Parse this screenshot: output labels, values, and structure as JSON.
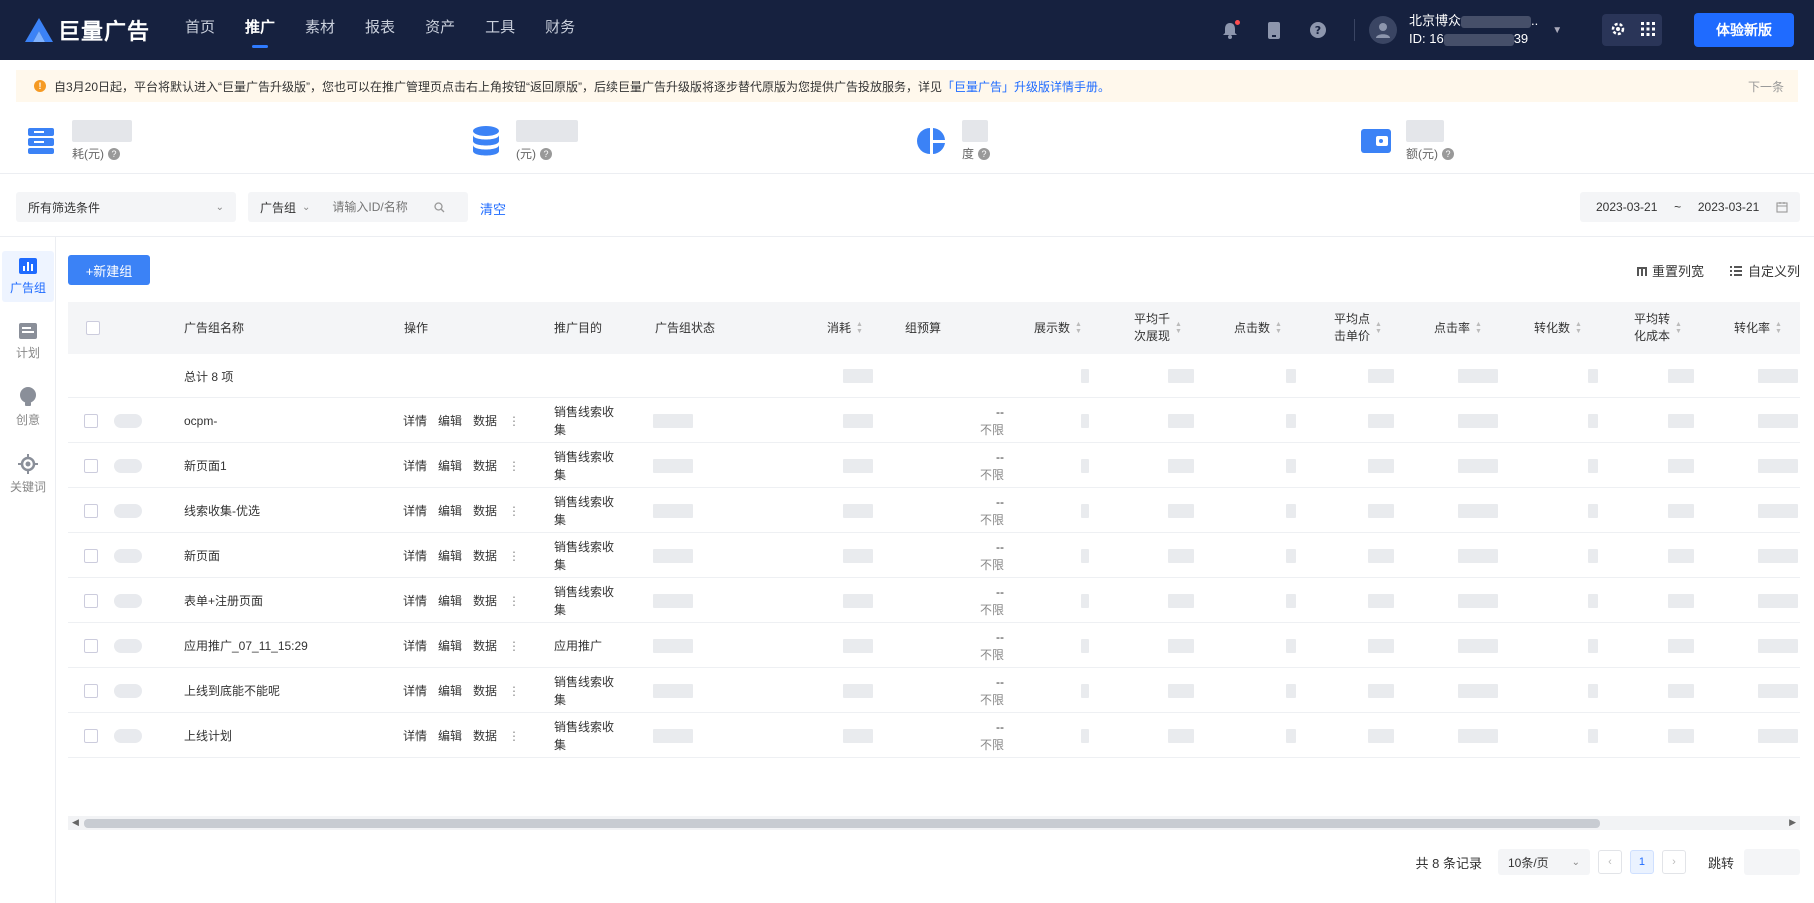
{
  "header": {
    "logo_text": "巨量广告",
    "nav": [
      "首页",
      "推广",
      "素材",
      "报表",
      "资产",
      "工具",
      "财务"
    ],
    "active_nav": "推广",
    "account_name": "北京博众",
    "account_name_suffix": "..",
    "account_id_prefix": "ID: 16",
    "account_id_suffix": "39",
    "new_version_button": "体验新版",
    "icons": [
      "bell-icon",
      "phone-icon",
      "help-icon",
      "user-icon",
      "settings-icon",
      "grid-icon"
    ]
  },
  "notice": {
    "text": "自3月20日起，平台将默认进入“巨量广告升级版”，您也可以在推广管理页点击右上角按钮“返回原版”，后续巨量广告升级版将逐步替代原版为您提供广告投放服务，详见",
    "link": "「巨量广告」升级版详情手册",
    "suffix": "。",
    "next": "下一条"
  },
  "stats": [
    {
      "label": "耗(元)",
      "icon": "wallet-stack-icon"
    },
    {
      "label": "(元)",
      "icon": "database-icon"
    },
    {
      "label": "度",
      "icon": "pie-chart-icon"
    },
    {
      "label": "额(元)",
      "icon": "card-wallet-icon"
    }
  ],
  "filters": {
    "all_conditions": "所有筛选条件",
    "dimension": "广告组",
    "search_placeholder": "请输入ID/名称",
    "clear": "清空",
    "date_start": "2023-03-21",
    "date_sep": "~",
    "date_end": "2023-03-21"
  },
  "sidebar": [
    {
      "label": "广告组",
      "icon": "bar-chart-icon",
      "active": true
    },
    {
      "label": "计划",
      "icon": "plan-icon",
      "active": false
    },
    {
      "label": "创意",
      "icon": "bulb-icon",
      "active": false
    },
    {
      "label": "关键词",
      "icon": "keyword-icon",
      "active": false
    }
  ],
  "toolbar": {
    "new_group": "+新建组",
    "reset_width": "重置列宽",
    "custom_columns": "自定义列"
  },
  "table": {
    "headers": {
      "name": "广告组名称",
      "ops": "操作",
      "purpose": "推广目的",
      "status": "广告组状态",
      "cost": "消耗",
      "budget": "组预算",
      "impressions": "展示数",
      "cpm_1": "平均千",
      "cpm_2": "次展现",
      "clicks": "点击数",
      "cpc_1": "平均点",
      "cpc_2": "击单价",
      "ctr": "点击率",
      "conversions": "转化数",
      "cpa_1": "平均转",
      "cpa_2": "化成本",
      "cvr": "转化率"
    },
    "total": "总计 8 项",
    "op_labels": [
      "详情",
      "编辑",
      "数据"
    ],
    "budget_dash": "--",
    "budget_unlimited": "不限",
    "rows": [
      {
        "name": "ocpm-",
        "purpose_1": "销售线索收",
        "purpose_2": "集"
      },
      {
        "name": "新页面1",
        "purpose_1": "销售线索收",
        "purpose_2": "集"
      },
      {
        "name": "线索收集-优选",
        "purpose_1": "销售线索收",
        "purpose_2": "集"
      },
      {
        "name": "新页面",
        "purpose_1": "销售线索收",
        "purpose_2": "集"
      },
      {
        "name": "表单+注册页面",
        "purpose_1": "销售线索收",
        "purpose_2": "集"
      },
      {
        "name": "应用推广_07_11_15:29",
        "purpose_1": "应用推广",
        "purpose_2": ""
      },
      {
        "name": "上线到底能不能呢",
        "purpose_1": "销售线索收",
        "purpose_2": "集"
      },
      {
        "name": "上线计划",
        "purpose_1": "销售线索收",
        "purpose_2": "集"
      }
    ]
  },
  "pagination": {
    "total_text": "共 8 条记录",
    "page_size": "10条/页",
    "current_page": "1",
    "jump_label": "跳转"
  }
}
